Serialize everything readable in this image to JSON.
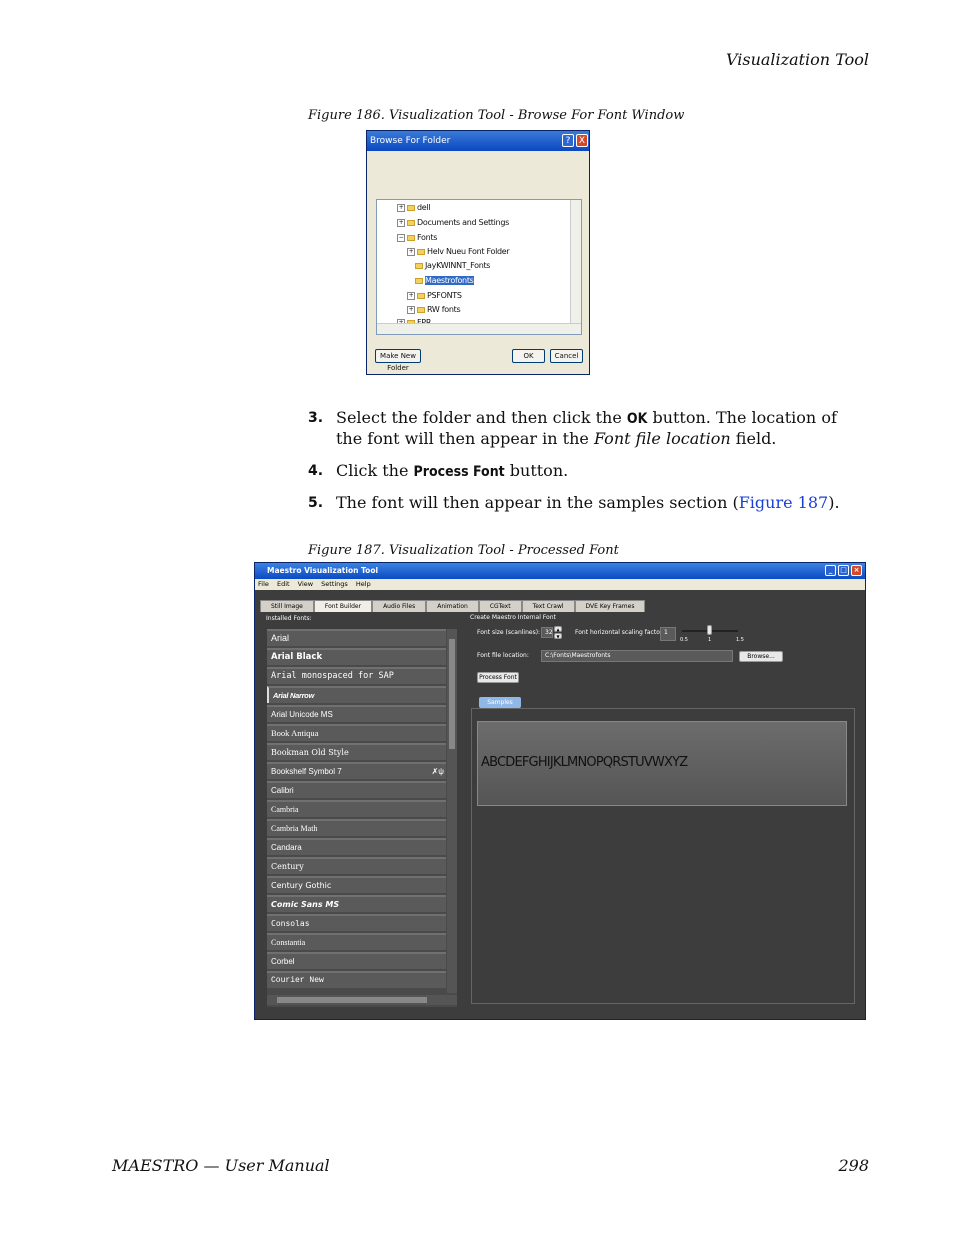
{
  "page": {
    "header": "Visualization Tool",
    "footer_left": "MAESTRO  —  User Manual",
    "page_number": "298"
  },
  "figure186": {
    "caption": "Figure 186.  Visualization Tool - Browse For Font Window",
    "dialog": {
      "title": "Browse For Folder",
      "help_glyph": "?",
      "close_glyph": "X",
      "tree": [
        {
          "label": "dell",
          "expander": "+"
        },
        {
          "label": "Documents and Settings",
          "expander": "+"
        },
        {
          "label": "Fonts",
          "expander": "−"
        },
        {
          "label": "Helv Nueu Font Folder",
          "expander": "+"
        },
        {
          "label": "JayKWINNT_Fonts",
          "expander": ""
        },
        {
          "label": "Maestrofonts",
          "expander": ""
        },
        {
          "label": "PSFONTS",
          "expander": "+"
        },
        {
          "label": "RW fonts",
          "expander": "+"
        },
        {
          "label": "FPR",
          "expander": "+"
        }
      ],
      "make_new_folder": "Make New Folder",
      "ok": "OK",
      "cancel": "Cancel"
    }
  },
  "steps": [
    {
      "num": "3.",
      "pre": "Select the folder and then click the ",
      "kw": "OK",
      "post": " button. The location of the font will then appear in the ",
      "em": "Font file location",
      "post2": " field."
    },
    {
      "num": "4.",
      "pre": "Click the ",
      "kw": "Process Font",
      "post": " button."
    },
    {
      "num": "5.",
      "pre": "The font will then appear in the samples section (",
      "link": "Figure 187",
      "post": ")."
    }
  ],
  "figure187": {
    "caption": "Figure 187.  Visualization Tool - Processed Font",
    "app": {
      "title": "Maestro Visualization Tool",
      "menu": [
        "File",
        "Edit",
        "View",
        "Settings",
        "Help"
      ],
      "tabs": [
        "Still Image",
        "Font Builder",
        "Audio Files",
        "Animation",
        "CGText",
        "Text Crawl",
        "DVE Key Frames"
      ],
      "installed_fonts_label": "Installed Fonts:",
      "fonts": [
        "Arial",
        "Arial Black",
        "Arial monospaced for SAP",
        "Arial Narrow",
        "Arial Unicode MS",
        "Book Antiqua",
        "Bookman Old Style",
        "Bookshelf Symbol 7",
        "Calibri",
        "Cambria",
        "Cambria Math",
        "Candara",
        "Century",
        "Century Gothic",
        "Comic Sans MS",
        "Consolas",
        "Constantia",
        "Corbel",
        "Courier New"
      ],
      "create_label": "Create Maestro Internal Font",
      "font_size_label": "Font size (scanlines):",
      "font_size_value": "32",
      "scaling_label": "Font horizontal scaling factor:",
      "scaling_value": "1",
      "scale_ticks": [
        "0.5",
        "1",
        "1.5"
      ],
      "font_file_label": "Font file location:",
      "font_file_value": "C:\\Fonts\\Maestrofonts",
      "browse": "Browse...",
      "process_font": "Process Font",
      "samples_tab": "Samples",
      "sample_text": "ABCDEFGHIJKLMNOPQRSTUVWXYZ"
    }
  }
}
